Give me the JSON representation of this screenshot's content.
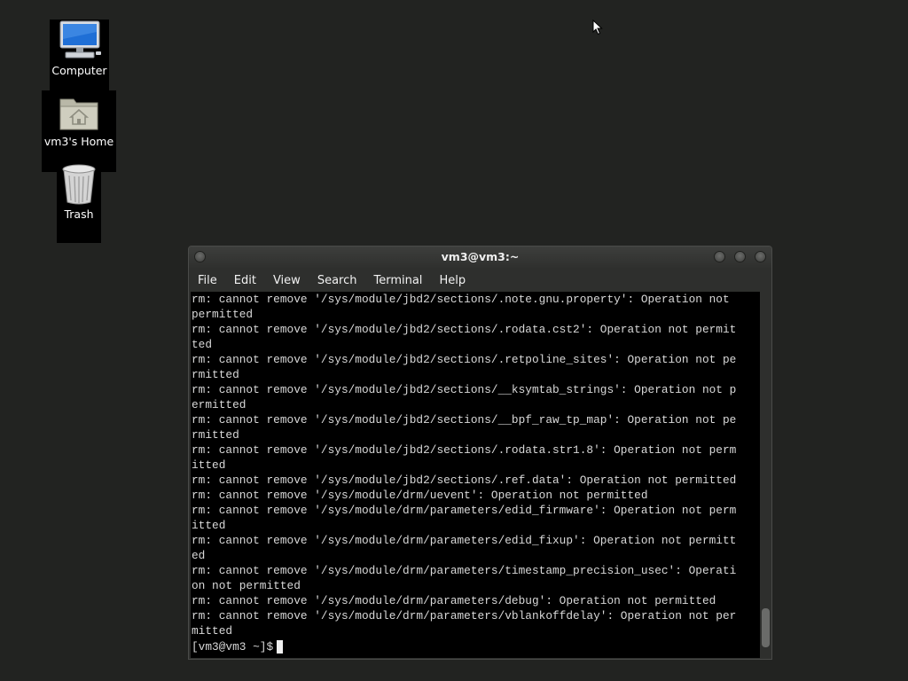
{
  "desktop": {
    "icons": [
      {
        "label": "Computer"
      },
      {
        "label": "vm3's Home"
      },
      {
        "label": "Trash"
      }
    ]
  },
  "terminal": {
    "title": "vm3@vm3:~",
    "menu": [
      "File",
      "Edit",
      "View",
      "Search",
      "Terminal",
      "Help"
    ],
    "lines": [
      "rm: cannot remove '/sys/module/jbd2/sections/.note.gnu.property': Operation not",
      "permitted",
      "rm: cannot remove '/sys/module/jbd2/sections/.rodata.cst2': Operation not permit",
      "ted",
      "rm: cannot remove '/sys/module/jbd2/sections/.retpoline_sites': Operation not pe",
      "rmitted",
      "rm: cannot remove '/sys/module/jbd2/sections/__ksymtab_strings': Operation not p",
      "ermitted",
      "rm: cannot remove '/sys/module/jbd2/sections/__bpf_raw_tp_map': Operation not pe",
      "rmitted",
      "rm: cannot remove '/sys/module/jbd2/sections/.rodata.str1.8': Operation not perm",
      "itted",
      "rm: cannot remove '/sys/module/jbd2/sections/.ref.data': Operation not permitted",
      "rm: cannot remove '/sys/module/drm/uevent': Operation not permitted",
      "rm: cannot remove '/sys/module/drm/parameters/edid_firmware': Operation not perm",
      "itted",
      "rm: cannot remove '/sys/module/drm/parameters/edid_fixup': Operation not permitt",
      "ed",
      "rm: cannot remove '/sys/module/drm/parameters/timestamp_precision_usec': Operati",
      "on not permitted",
      "rm: cannot remove '/sys/module/drm/parameters/debug': Operation not permitted",
      "rm: cannot remove '/sys/module/drm/parameters/vblankoffdelay': Operation not per",
      "mitted"
    ],
    "prompt": "[vm3@vm3 ~]$"
  }
}
